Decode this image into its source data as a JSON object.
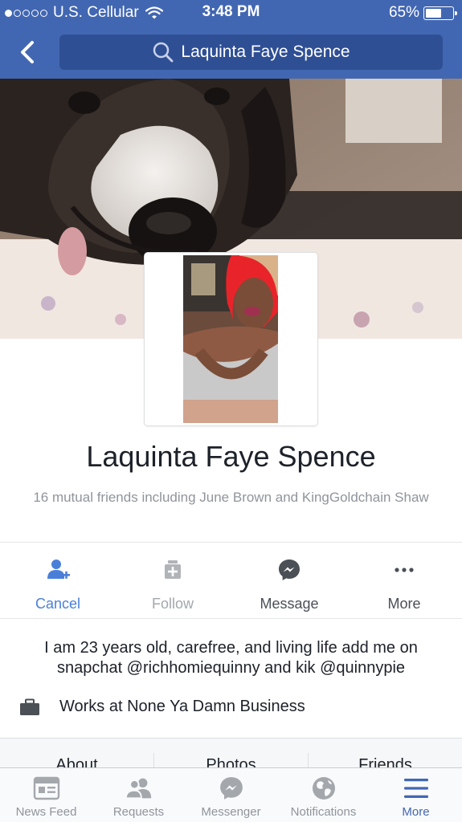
{
  "status_bar": {
    "carrier": "U.S. Cellular",
    "time": "3:48 PM",
    "battery": "65%",
    "battery_level": 0.65,
    "signal_bars": 1,
    "signal_total": 5
  },
  "nav": {
    "search_text": "Laquinta Faye Spence",
    "back_icon": "chevron-left-icon",
    "search_icon": "search-icon"
  },
  "profile": {
    "name": "Laquinta Faye Spence",
    "mutual_friends": "16 mutual friends including June Brown and KingGoldchain Shaw"
  },
  "actions": [
    {
      "label": "Cancel",
      "icon": "person-add-icon",
      "color": "#4a7fd9"
    },
    {
      "label": "Follow",
      "icon": "follow-icon",
      "color": "#a4a7ac"
    },
    {
      "label": "Message",
      "icon": "messenger-icon",
      "color": "#4b4f56"
    },
    {
      "label": "More",
      "icon": "more-icon",
      "color": "#4b4f56"
    }
  ],
  "bio": "I am 23 years old, carefree, and living life add me on snapchat @richhomiequinny and kik @quinnypie",
  "work": {
    "text": "Works at None Ya Damn Business",
    "icon": "briefcase-icon"
  },
  "tabs": [
    "About",
    "Photos",
    "Friends"
  ],
  "bottom_nav": [
    {
      "label": "News Feed",
      "icon": "news-feed-icon",
      "active": false
    },
    {
      "label": "Requests",
      "icon": "requests-icon",
      "active": false
    },
    {
      "label": "Messenger",
      "icon": "messenger-icon",
      "active": false
    },
    {
      "label": "Notifications",
      "icon": "globe-icon",
      "active": false
    },
    {
      "label": "More",
      "icon": "menu-icon",
      "active": true
    }
  ],
  "colors": {
    "brand": "#4267b2",
    "search_field": "#2f4f94",
    "active_tab": "#4267b2",
    "inactive_text": "#90949c"
  }
}
